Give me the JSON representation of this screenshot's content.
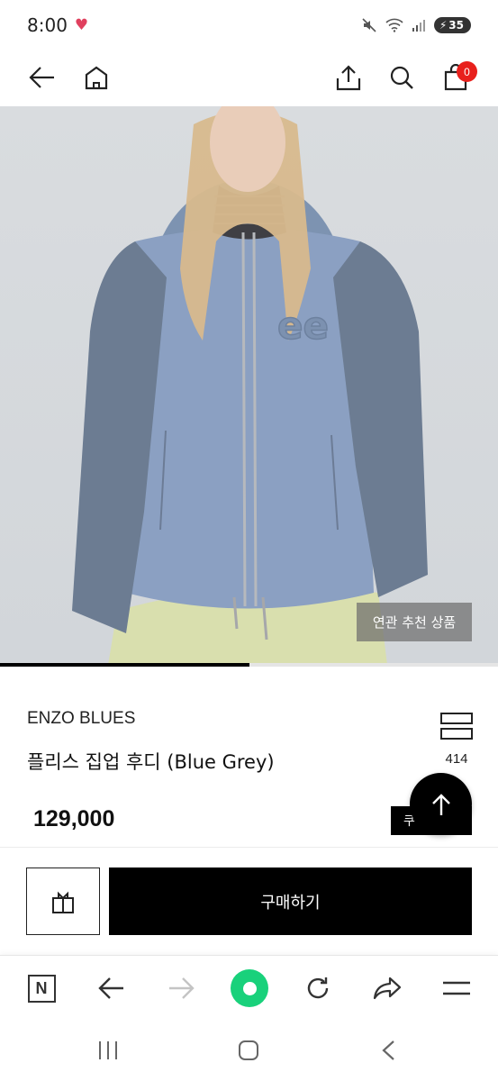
{
  "status_bar": {
    "time": "8:00",
    "battery": "35"
  },
  "header": {
    "cart_count": "0"
  },
  "hero": {
    "recommend_label": "연관 추천 상품",
    "progress": 0.5,
    "print_text": "ee"
  },
  "product": {
    "brand": "ENZO BLUES",
    "name": "플리스 집업 후디 (Blue Grey)",
    "price": "129,000",
    "like_count": "414",
    "coupon_label": "쿠"
  },
  "actions": {
    "buy_label": "구매하기"
  },
  "browser": {
    "n_label": "N"
  },
  "colors": {
    "accent": "#000000",
    "badge": "#e8201c",
    "browser_home": "#19d17b"
  },
  "icons": [
    "back-icon",
    "home-icon",
    "share-icon",
    "search-icon",
    "cart-icon",
    "like-icon",
    "arrow-up-icon",
    "gift-icon",
    "naver-n-icon",
    "browser-back-icon",
    "browser-forward-icon",
    "browser-home-icon",
    "refresh-icon",
    "share-arrow-icon",
    "menu-icon",
    "recent-apps-icon",
    "sys-home-icon",
    "sys-back-icon"
  ]
}
